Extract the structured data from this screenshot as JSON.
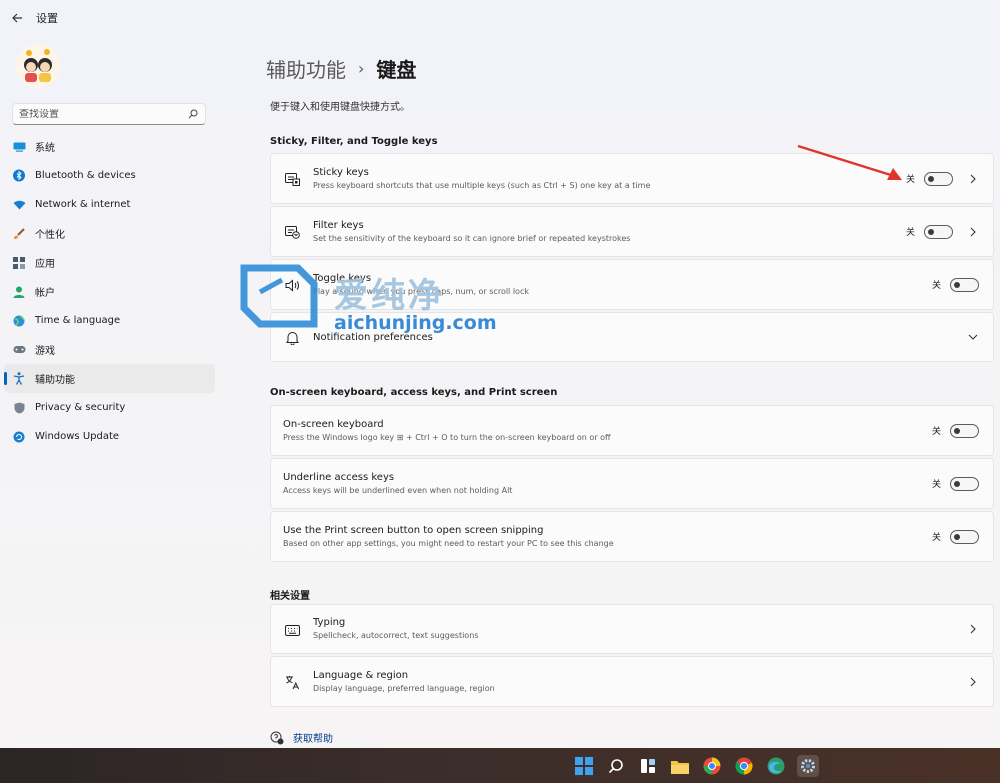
{
  "app": {
    "title": "设置"
  },
  "search": {
    "placeholder": "查找设置"
  },
  "sidebar": {
    "items": [
      {
        "label": "系统",
        "icon": "system-icon"
      },
      {
        "label": "Bluetooth & devices",
        "icon": "bluetooth-icon"
      },
      {
        "label": "Network & internet",
        "icon": "wifi-icon"
      },
      {
        "label": "个性化",
        "icon": "brush-icon"
      },
      {
        "label": "应用",
        "icon": "apps-icon"
      },
      {
        "label": "帐户",
        "icon": "person-icon"
      },
      {
        "label": "Time & language",
        "icon": "globe-icon"
      },
      {
        "label": "游戏",
        "icon": "game-controller-icon"
      },
      {
        "label": "辅助功能",
        "icon": "accessibility-icon",
        "active": true
      },
      {
        "label": "Privacy & security",
        "icon": "shield-icon"
      },
      {
        "label": "Windows Update",
        "icon": "update-icon"
      }
    ]
  },
  "page": {
    "breadcrumb_parent": "辅助功能",
    "breadcrumb_sep": "›",
    "breadcrumb_current": "键盘",
    "description": "便于键入和使用键盘快捷方式。"
  },
  "sections": {
    "sticky": {
      "title": "Sticky, Filter, and Toggle keys",
      "items": [
        {
          "title": "Sticky keys",
          "subtitle": "Press keyboard shortcuts that use multiple keys (such as Ctrl + S) one key at a time",
          "state": "关",
          "icon": "sticky-keys-icon"
        },
        {
          "title": "Filter keys",
          "subtitle": "Set the sensitivity of the keyboard so it can ignore brief or repeated keystrokes",
          "state": "关",
          "icon": "filter-keys-icon"
        },
        {
          "title": "Toggle keys",
          "subtitle": "Play a sound when you press caps, num, or scroll lock",
          "state": "关",
          "icon": "speaker-icon"
        },
        {
          "title": "Notification preferences",
          "icon": "bell-icon"
        }
      ]
    },
    "onscreen": {
      "title": "On-screen keyboard, access keys, and Print screen",
      "items": [
        {
          "title": "On-screen keyboard",
          "subtitle": "Press the Windows logo key ⊞ + Ctrl + O to turn the on-screen keyboard on or off",
          "state": "关"
        },
        {
          "title": "Underline access keys",
          "subtitle": "Access keys will be underlined even when not holding Alt",
          "state": "关"
        },
        {
          "title": "Use the Print screen button to open screen snipping",
          "subtitle": "Based on other app settings, you might need to restart your PC to see this change",
          "state": "关"
        }
      ]
    },
    "related": {
      "title": "相关设置",
      "items": [
        {
          "title": "Typing",
          "subtitle": "Spellcheck, autocorrect, text suggestions",
          "icon": "keyboard-icon"
        },
        {
          "title": "Language & region",
          "subtitle": "Display language, preferred language, region",
          "icon": "language-icon"
        }
      ]
    }
  },
  "help": {
    "label": "获取帮助"
  },
  "watermark": {
    "text": "爱纯净",
    "url": "aichunjing.com"
  },
  "colors": {
    "accent": "#0067c0",
    "arrow": "#e0352b",
    "taskbar": "#3a2d2a"
  }
}
